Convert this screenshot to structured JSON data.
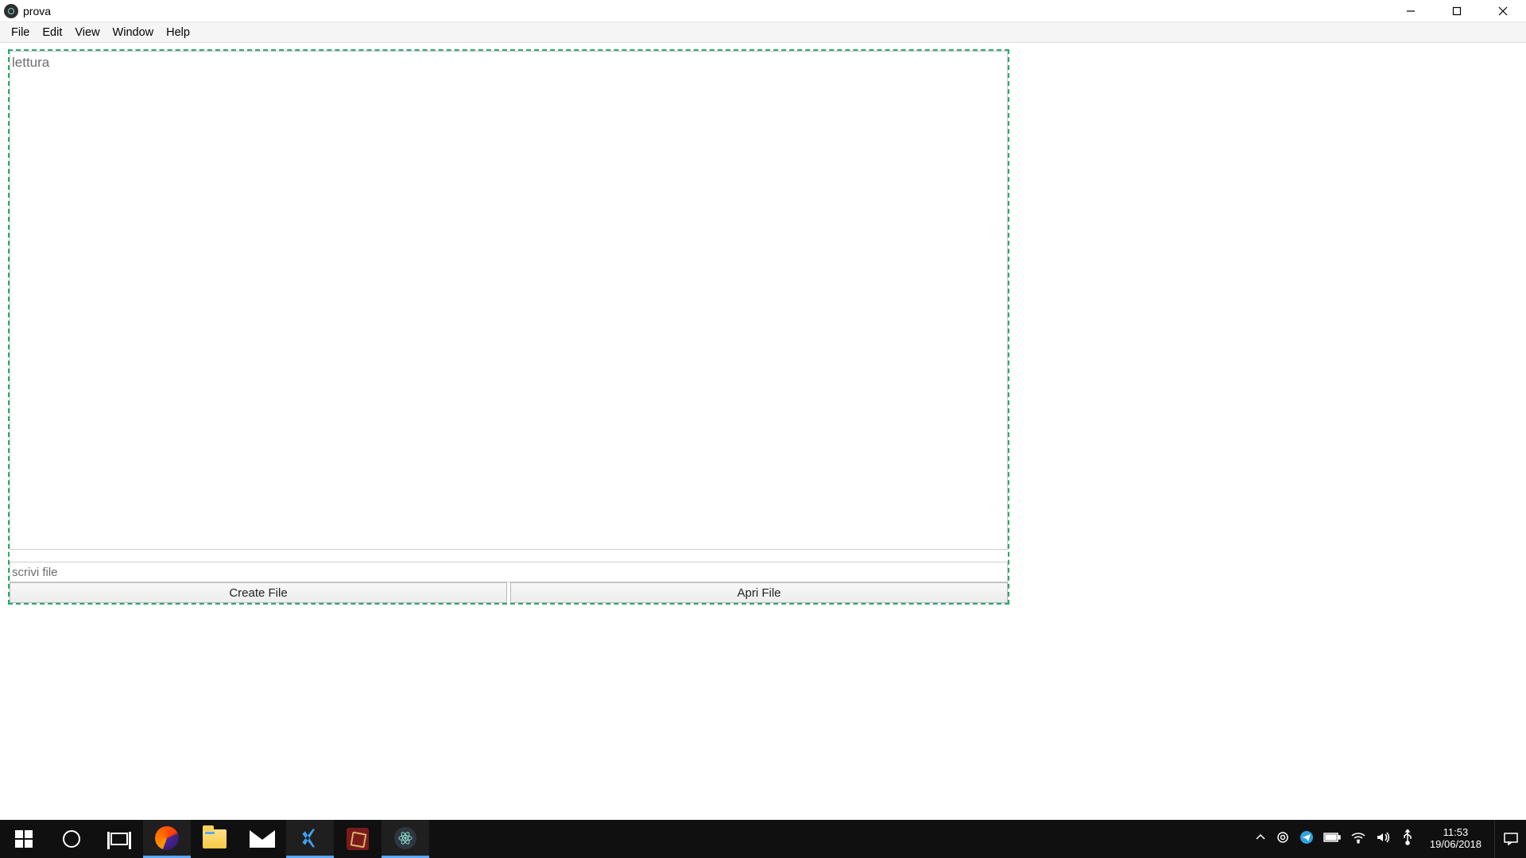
{
  "window": {
    "title": "prova"
  },
  "menu": {
    "items": [
      "File",
      "Edit",
      "View",
      "Window",
      "Help"
    ]
  },
  "app": {
    "read_placeholder": "lettura",
    "write_placeholder": "scrivi file",
    "buttons": {
      "create": "Create File",
      "open": "Apri File"
    }
  },
  "taskbar": {
    "clock_time": "11:53",
    "clock_date": "19/06/2018"
  },
  "colors": {
    "dashed_border": "#2aa86b"
  }
}
